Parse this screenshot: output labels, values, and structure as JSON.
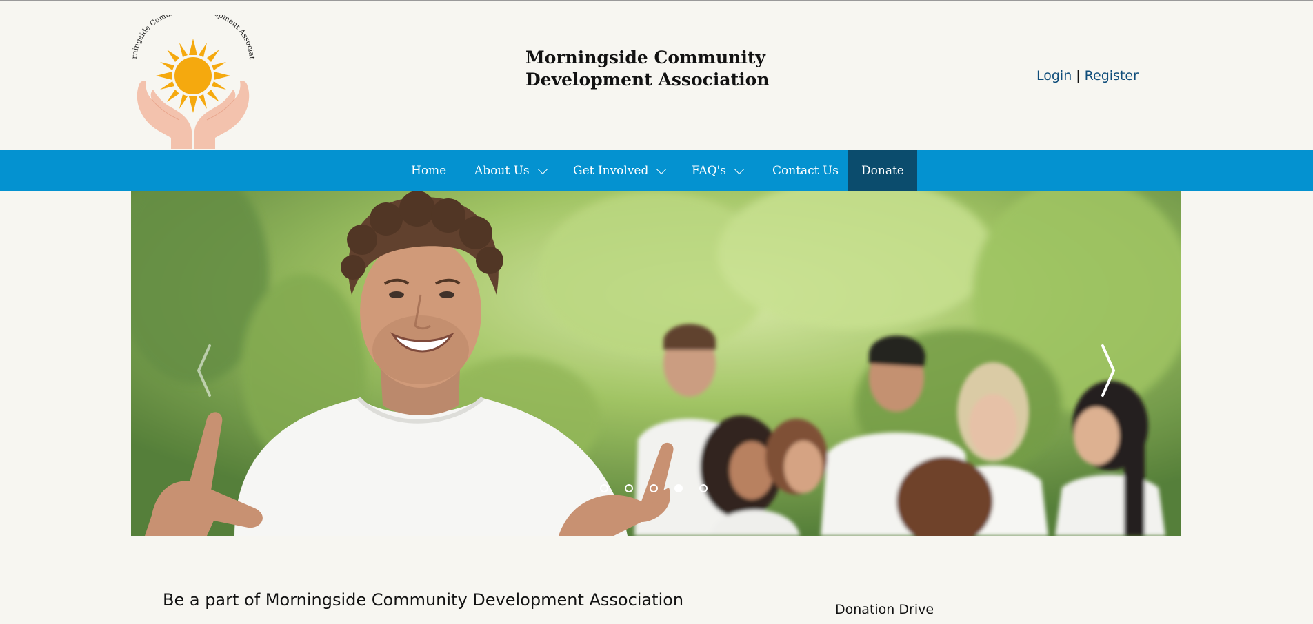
{
  "logo": {
    "arc_text": "Morningside Community Development Association",
    "icon": "sun-in-hands-logo-icon"
  },
  "site_title": {
    "line1": "Morningside Community",
    "line2": "Development Association"
  },
  "auth": {
    "login": "Login",
    "separator": "|",
    "register": "Register"
  },
  "nav": {
    "items": [
      {
        "label": "Home",
        "dropdown": false
      },
      {
        "label": "About Us",
        "dropdown": true
      },
      {
        "label": "Get Involved",
        "dropdown": true
      },
      {
        "label": "FAQ's",
        "dropdown": true
      },
      {
        "label": "Contact Us",
        "dropdown": false
      }
    ],
    "donate": "Donate"
  },
  "hero": {
    "prev_icon": "chevron-left-icon",
    "next_icon": "chevron-right-icon",
    "slide_count": 5,
    "active_slide": 4,
    "image": "volunteers-group-photo"
  },
  "content": {
    "heading": "Be a part of Morningside Community Development Association",
    "sidebar_heading": "Donation Drive"
  },
  "colors": {
    "background": "#f7f6f1",
    "nav": "#0492d0",
    "donate": "#0b4c6d",
    "link": "#0f4d7a",
    "sun": "#f5a90e",
    "hands": "#f3c2ad"
  }
}
